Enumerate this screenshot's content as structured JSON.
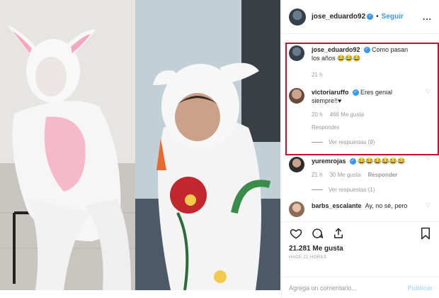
{
  "header": {
    "username": "jose_eduardo92",
    "dot": "•",
    "follow_label": "Seguir",
    "more_label": "..."
  },
  "comments": [
    {
      "username": "jose_eduardo92",
      "text": "Como pasan los años 😂😂😂",
      "time": "21 h"
    },
    {
      "username": "victoriaruffo",
      "text": "Eres genial siempre!!♥",
      "time": "20 h",
      "likes": "466 Me gusta",
      "reply_label": "Responder",
      "view_replies": "Ver respuestas (9)"
    },
    {
      "username": "yuremrojas",
      "text": "😂😂😂😂😂😂",
      "time": "21 h",
      "likes": "30 Me gusta",
      "reply_label": "Responder",
      "view_replies": "Ver respuestas (1)"
    },
    {
      "username": "barbs_escalante",
      "text": "Ay, no sé, pero"
    }
  ],
  "actions": {
    "likes_count": "21.281 Me gusta",
    "timestamp": "HACE 21 HORAS",
    "comment_placeholder": "Agrega un comentario...",
    "post_label": "Publicar"
  },
  "colors": {
    "accent": "#3897f0",
    "highlight": "#c8102e",
    "meta": "#999999"
  }
}
